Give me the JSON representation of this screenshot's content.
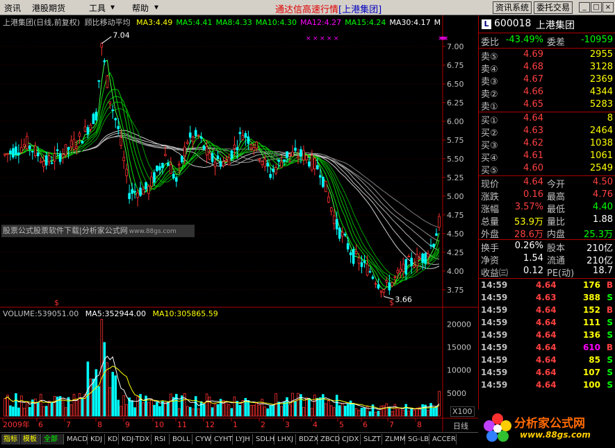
{
  "menu": {
    "items": [
      "资讯",
      "港股期货",
      "工具",
      "帮助"
    ],
    "title": "通达信高速行情",
    "title_company": "[上港集团]",
    "buttons": [
      "资讯系统",
      "委托交易"
    ],
    "win_controls": [
      "minimize",
      "maximize",
      "close"
    ]
  },
  "chart": {
    "header": {
      "stock": "上港集团(日线,前复权)",
      "indicator": "顾比移动平均",
      "ma": [
        {
          "label": "MA3:4.49",
          "color": "#ffff00"
        },
        {
          "label": "MA5:4.41",
          "color": "#00ff00"
        },
        {
          "label": "MA8:4.33",
          "color": "#00ff00"
        },
        {
          "label": "MA10:4.30",
          "color": "#00ff00"
        },
        {
          "label": "MA12:4.27",
          "color": "#ff00ff"
        },
        {
          "label": "MA15:4.24",
          "color": "#00ff00"
        },
        {
          "label": "MA30:4.17",
          "color": "#ffffff"
        },
        {
          "label": "M",
          "color": "#ffffff"
        }
      ]
    },
    "price_axis": {
      "ticks": [
        "7.00",
        "6.75",
        "6.50",
        "6.25",
        "6.00",
        "5.75",
        "5.50",
        "5.25",
        "5.00",
        "4.75",
        "4.50",
        "4.25",
        "4.00",
        "3.75"
      ]
    },
    "annotations": {
      "high": "7.04",
      "low": "3.66",
      "marker": "$"
    },
    "volume_header": {
      "volume": "VOLUME:539051.00",
      "ma5": "MA5:352944.00",
      "ma10": "MA10:305865.59"
    },
    "volume_axis": {
      "ticks": [
        "20000",
        "15000",
        "10000",
        "5000"
      ],
      "multiplier": "X100"
    },
    "time_axis": {
      "labels": [
        "2009年",
        "6",
        "7",
        "8",
        "9",
        "10",
        "11",
        "12",
        "1",
        "2",
        "3",
        "4",
        "5",
        "6",
        "7",
        "8"
      ]
    },
    "period": "日线"
  },
  "watermark": {
    "text": "股票公式股票软件下载|分析家公式网",
    "url": "www.88gs.com"
  },
  "tabs": [
    "指标",
    "模板",
    "全部",
    "MACD",
    "KDJ",
    "KD",
    "KDJ-TDX",
    "RSI",
    "BOLL",
    "CYW",
    "CYHT",
    "LYJH",
    "SDLH",
    "LHXJ",
    "BDZX",
    "ZBCD",
    "CJDX",
    "SLZT",
    "ZLMM",
    "SG-LB",
    "ACCER"
  ],
  "quote": {
    "code": "600018",
    "name": "上港集团",
    "logo": "L",
    "weibi": {
      "label": "委比",
      "value": "-43.49%",
      "label2": "委差",
      "value2": "-10959"
    },
    "asks": [
      {
        "label": "卖⑤",
        "price": "4.69",
        "vol": "2955"
      },
      {
        "label": "卖④",
        "price": "4.68",
        "vol": "3128"
      },
      {
        "label": "卖③",
        "price": "4.67",
        "vol": "2369"
      },
      {
        "label": "卖②",
        "price": "4.66",
        "vol": "4344"
      },
      {
        "label": "卖①",
        "price": "4.65",
        "vol": "5283"
      }
    ],
    "bids": [
      {
        "label": "买①",
        "price": "4.64",
        "vol": "8"
      },
      {
        "label": "买②",
        "price": "4.63",
        "vol": "2464"
      },
      {
        "label": "买③",
        "price": "4.62",
        "vol": "1038"
      },
      {
        "label": "买④",
        "price": "4.61",
        "vol": "1061"
      },
      {
        "label": "买⑤",
        "price": "4.60",
        "vol": "2549"
      }
    ],
    "stats": [
      {
        "l1": "现价",
        "v1": "4.64",
        "c1": "#ff4040",
        "l2": "今开",
        "v2": "4.50",
        "c2": "#ff4040"
      },
      {
        "l1": "涨跌",
        "v1": "0.16",
        "c1": "#ff4040",
        "l2": "最高",
        "v2": "4.76",
        "c2": "#ff4040"
      },
      {
        "l1": "涨幅",
        "v1": "3.57%",
        "c1": "#ff4040",
        "l2": "最低",
        "v2": "4.40",
        "c2": "#00ff00"
      },
      {
        "l1": "总量",
        "v1": "53.9万",
        "c1": "#ffff00",
        "l2": "量比",
        "v2": "1.88",
        "c2": "#ffffff"
      },
      {
        "l1": "外盘",
        "v1": "28.6万",
        "c1": "#ff4040",
        "l2": "内盘",
        "v2": "25.3万",
        "c2": "#00ff00"
      }
    ],
    "fundamentals": [
      {
        "l1": "换手",
        "v1": "0.26%",
        "l2": "股本",
        "v2": "210亿"
      },
      {
        "l1": "净资",
        "v1": "1.54",
        "l2": "流通",
        "v2": "210亿"
      },
      {
        "l1": "收益㈢",
        "v1": "0.12",
        "l2": "PE(动)",
        "v2": "18.7"
      }
    ],
    "trades": [
      {
        "time": "14:59",
        "price": "4.64",
        "vol": "176",
        "flag": "B",
        "vc": "#ffff00",
        "fc": "#ff4040"
      },
      {
        "time": "14:59",
        "price": "4.63",
        "vol": "388",
        "flag": "S",
        "vc": "#ffff00",
        "fc": "#00ff00"
      },
      {
        "time": "14:59",
        "price": "4.64",
        "vol": "152",
        "flag": "B",
        "vc": "#ffff00",
        "fc": "#ff4040"
      },
      {
        "time": "14:59",
        "price": "4.64",
        "vol": "111",
        "flag": "S",
        "vc": "#ffff00",
        "fc": "#00ff00"
      },
      {
        "time": "14:59",
        "price": "4.64",
        "vol": "136",
        "flag": "S",
        "vc": "#ffff00",
        "fc": "#00ff00"
      },
      {
        "time": "14:59",
        "price": "4.64",
        "vol": "610",
        "flag": "B",
        "vc": "#ff00ff",
        "fc": "#ff4040"
      },
      {
        "time": "14:59",
        "price": "4.64",
        "vol": "85",
        "flag": "S",
        "vc": "#ffff00",
        "fc": "#00ff00"
      },
      {
        "time": "14:59",
        "price": "4.64",
        "vol": "107",
        "flag": "S",
        "vc": "#ffff00",
        "fc": "#00ff00"
      },
      {
        "time": "14:59",
        "price": "4.64",
        "vol": "100",
        "flag": "S",
        "vc": "#ffff00",
        "fc": "#00ff00"
      }
    ]
  },
  "logo": {
    "text": "分析家公式网",
    "url": "www.88gs.com"
  }
}
